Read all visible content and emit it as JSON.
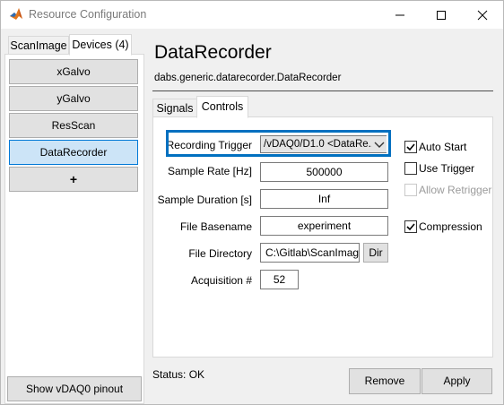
{
  "window": {
    "title": "Resource Configuration"
  },
  "left_tabs": [
    {
      "label": "ScanImage"
    },
    {
      "label": "Devices (4)"
    }
  ],
  "devices": [
    {
      "label": "xGalvo"
    },
    {
      "label": "yGalvo"
    },
    {
      "label": "ResScan"
    },
    {
      "label": "DataRecorder"
    }
  ],
  "add_button": {
    "label": "+"
  },
  "pinout_button": {
    "label": "Show vDAQ0 pinout"
  },
  "header": {
    "title": "DataRecorder",
    "subtitle": "dabs.generic.datarecorder.DataRecorder"
  },
  "right_tabs": [
    {
      "label": "Signals"
    },
    {
      "label": "Controls"
    }
  ],
  "controls": {
    "recording_trigger_label": "Recording Trigger",
    "recording_trigger_value": "/vDAQ0/D1.0 <DataRe...",
    "sample_rate_label": "Sample Rate [Hz]",
    "sample_rate_value": "500000",
    "sample_duration_label": "Sample Duration [s]",
    "sample_duration_value": "Inf",
    "file_basename_label": "File Basename",
    "file_basename_value": "experiment",
    "file_directory_label": "File Directory",
    "file_directory_value": "C:\\Gitlab\\ScanImage",
    "dir_button_label": "Dir",
    "acquisition_label": "Acquisition #",
    "acquisition_value": "52",
    "auto_start_label": "Auto Start",
    "use_trigger_label": "Use Trigger",
    "allow_retrigger_label": "Allow Retrigger",
    "compression_label": "Compression"
  },
  "checkbox_states": {
    "auto_start": true,
    "use_trigger": false,
    "allow_retrigger": false,
    "compression": true
  },
  "status": {
    "text": "Status: OK"
  },
  "footer_buttons": {
    "remove_label": "Remove",
    "apply_label": "Apply"
  },
  "colors": {
    "focus_highlight": "#0070c0",
    "selected_device_bg": "#cce4f7",
    "selected_device_border": "#0078d7"
  }
}
